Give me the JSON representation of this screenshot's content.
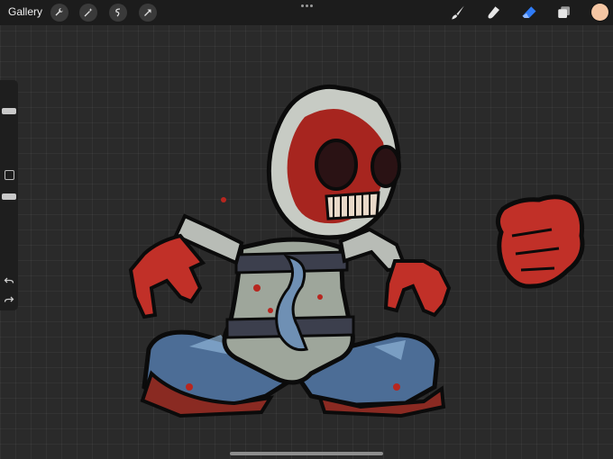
{
  "app": {
    "gallery_label": "Gallery"
  },
  "toolbar_left": {
    "icons": [
      "wrench-icon",
      "magic-wand-icon",
      "selection-icon",
      "transform-arrow-icon"
    ]
  },
  "toolbar_right": {
    "icons": [
      "brush-icon",
      "smudge-icon",
      "eraser-icon",
      "layers-icon"
    ],
    "active_tool": "eraser-icon",
    "current_color": "#f5c6a3",
    "accent": "#2f7bf6"
  },
  "sidebar": {
    "brush_size": 0.4,
    "opacity": 0.75,
    "icons": [
      "modify-square-icon",
      "undo-icon",
      "redo-icon"
    ]
  }
}
